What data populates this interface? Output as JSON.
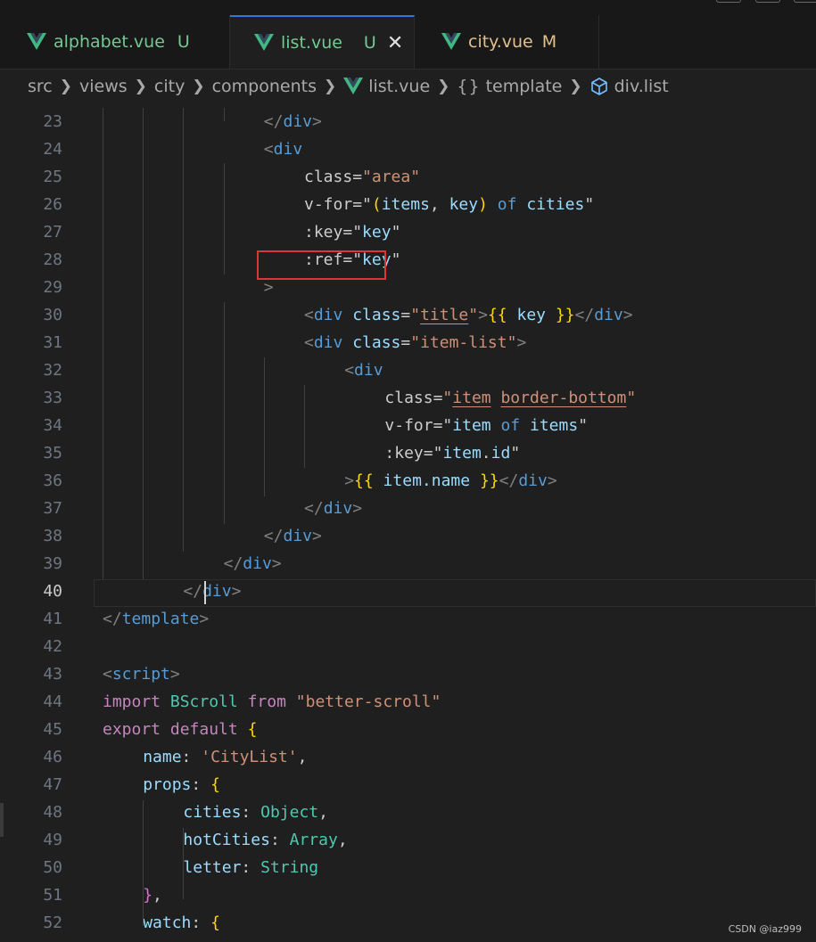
{
  "tabs": [
    {
      "name": "alphabet.vue",
      "flag": "U"
    },
    {
      "name": "list.vue",
      "flag": "U",
      "active": true
    },
    {
      "name": "city.vue",
      "flag": "M"
    }
  ],
  "breadcrumb": [
    "src",
    "views",
    "city",
    "components",
    "list.vue",
    "template",
    "div.list"
  ],
  "editor": {
    "current_line": 40,
    "lines": [
      {
        "n": 23,
        "text": "        </div>"
      },
      {
        "n": 24,
        "text": "        <div"
      },
      {
        "n": 25,
        "text": "          class=\"area\""
      },
      {
        "n": 26,
        "text": "          v-for=\"(items, key) of cities\""
      },
      {
        "n": 27,
        "text": "          :key=\"key\""
      },
      {
        "n": 28,
        "text": "          :ref=\"key\""
      },
      {
        "n": 29,
        "text": "        >"
      },
      {
        "n": 30,
        "text": "          <div class=\"title\">{{ key }}</div>"
      },
      {
        "n": 31,
        "text": "          <div class=\"item-list\">"
      },
      {
        "n": 32,
        "text": "            <div"
      },
      {
        "n": 33,
        "text": "              class=\"item border-bottom\""
      },
      {
        "n": 34,
        "text": "              v-for=\"item of items\""
      },
      {
        "n": 35,
        "text": "              :key=\"item.id\""
      },
      {
        "n": 36,
        "text": "            >{{ item.name }}</div>"
      },
      {
        "n": 37,
        "text": "          </div>"
      },
      {
        "n": 38,
        "text": "        </div>"
      },
      {
        "n": 39,
        "text": "      </div>"
      },
      {
        "n": 40,
        "text": "    </div>"
      },
      {
        "n": 41,
        "text": "</template>"
      },
      {
        "n": 42,
        "text": ""
      },
      {
        "n": 43,
        "text": "<script>"
      },
      {
        "n": 44,
        "text": "import BScroll from \"better-scroll\""
      },
      {
        "n": 45,
        "text": "export default {"
      },
      {
        "n": 46,
        "text": "  name: 'CityList',"
      },
      {
        "n": 47,
        "text": "  props: {"
      },
      {
        "n": 48,
        "text": "    cities: Object,"
      },
      {
        "n": 49,
        "text": "    hotCities: Array,"
      },
      {
        "n": 50,
        "text": "    letter: String"
      },
      {
        "n": 51,
        "text": "  },"
      },
      {
        "n": 52,
        "text": "  watch: {"
      }
    ]
  },
  "watermark": "CSDN @iaz999",
  "colors": {
    "highlight_box": "#e03535",
    "untracked": "#73c991",
    "modified": "#e2c08d"
  }
}
